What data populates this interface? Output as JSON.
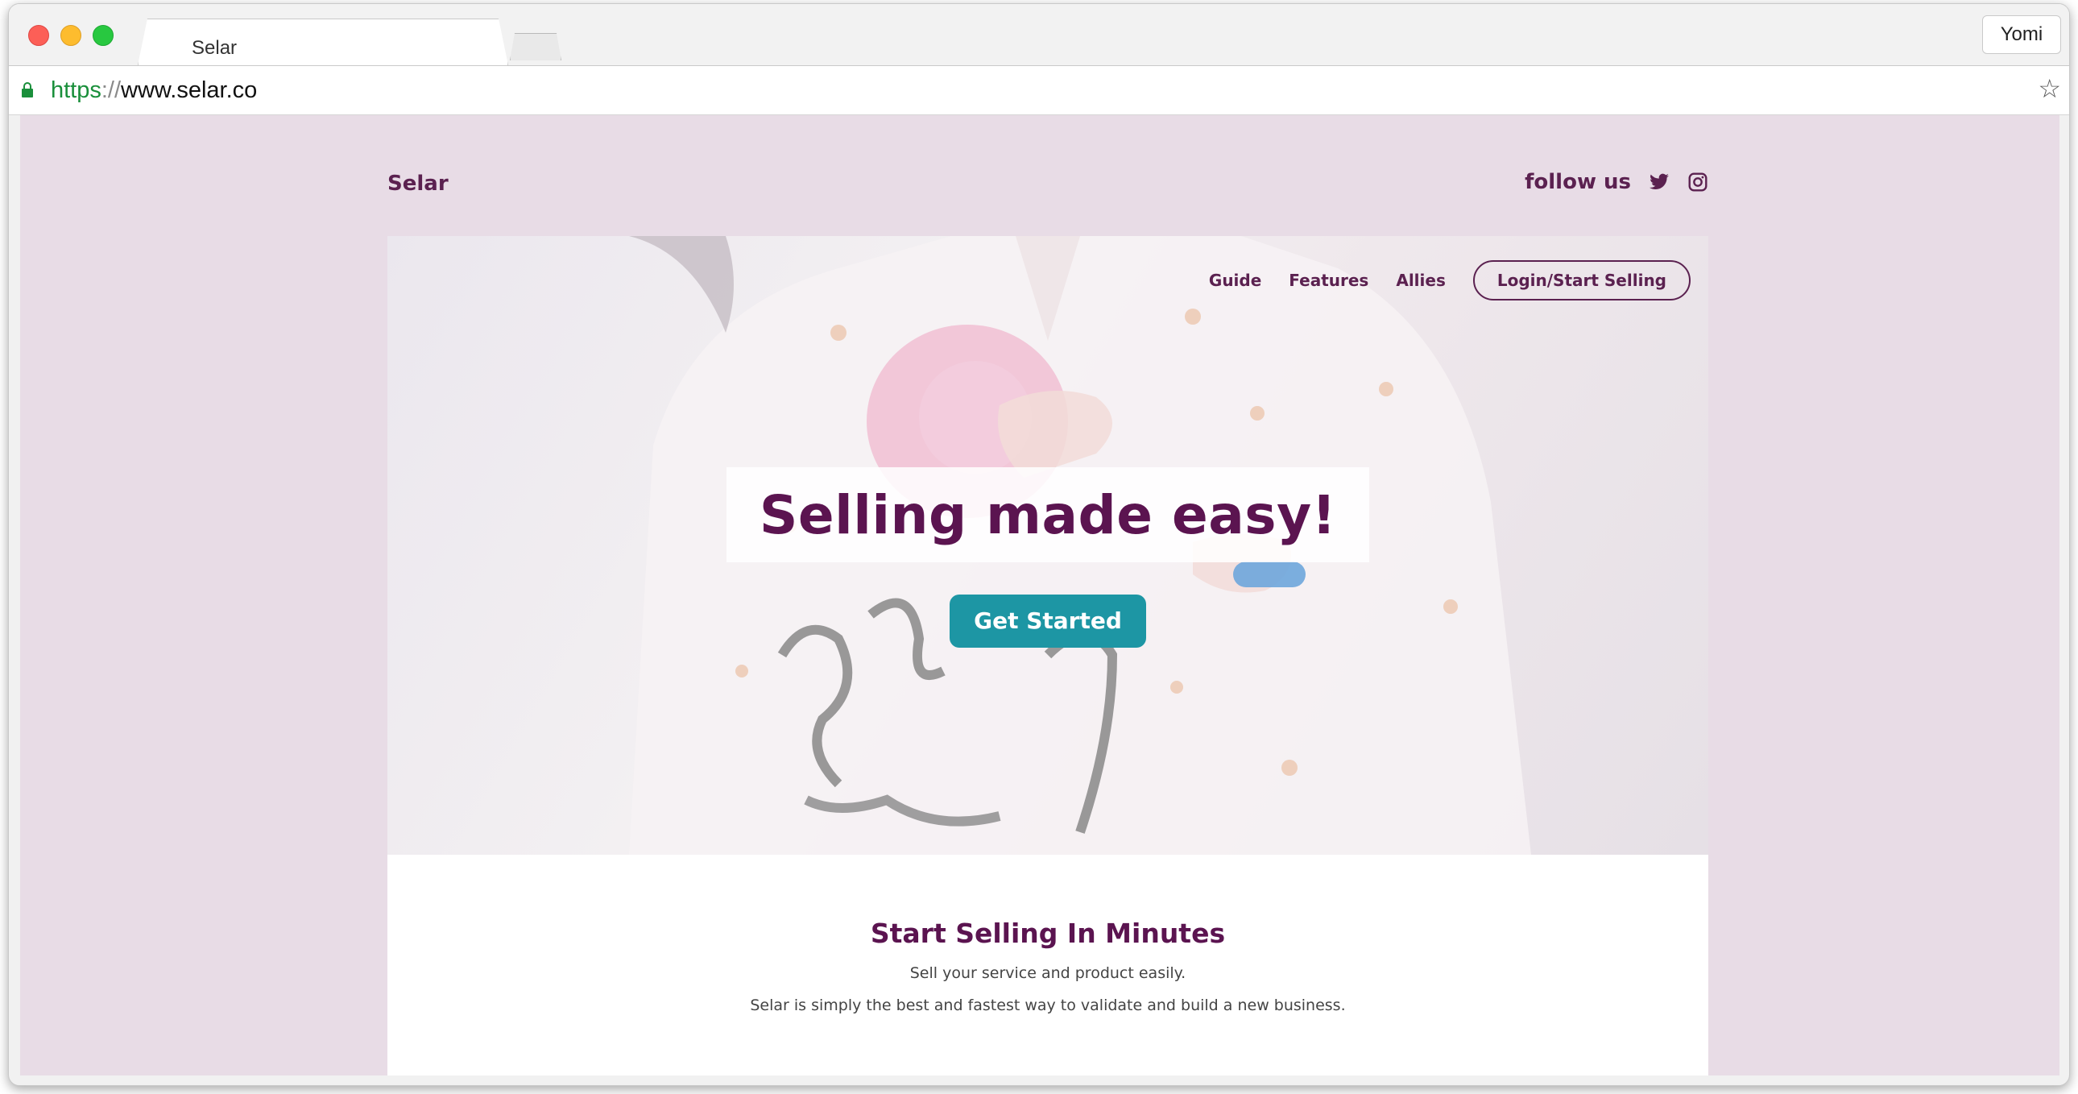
{
  "browser": {
    "tab_title": "Selar",
    "profile_name": "Yomi",
    "url": {
      "scheme": "https",
      "separator": "://",
      "host": "www.selar.co"
    },
    "icons": [
      "lock-icon",
      "star-icon"
    ]
  },
  "site": {
    "brand": "Selar",
    "follow_label": "follow us",
    "social_icons": [
      "twitter-icon",
      "instagram-icon"
    ],
    "nav": {
      "guide": "Guide",
      "features": "Features",
      "allies": "Allies",
      "login": "Login/Start Selling"
    },
    "hero": {
      "headline": "Selling made easy!",
      "cta": "Get Started"
    },
    "section": {
      "title": "Start Selling In Minutes",
      "subtitle": "Sell your service and product easily.",
      "description": "Selar is simply the best and fastest way to validate and build a new business."
    }
  },
  "colors": {
    "brand_purple": "#5b1450",
    "cta_teal": "#1d96a4",
    "page_background": "#e8dce6"
  }
}
